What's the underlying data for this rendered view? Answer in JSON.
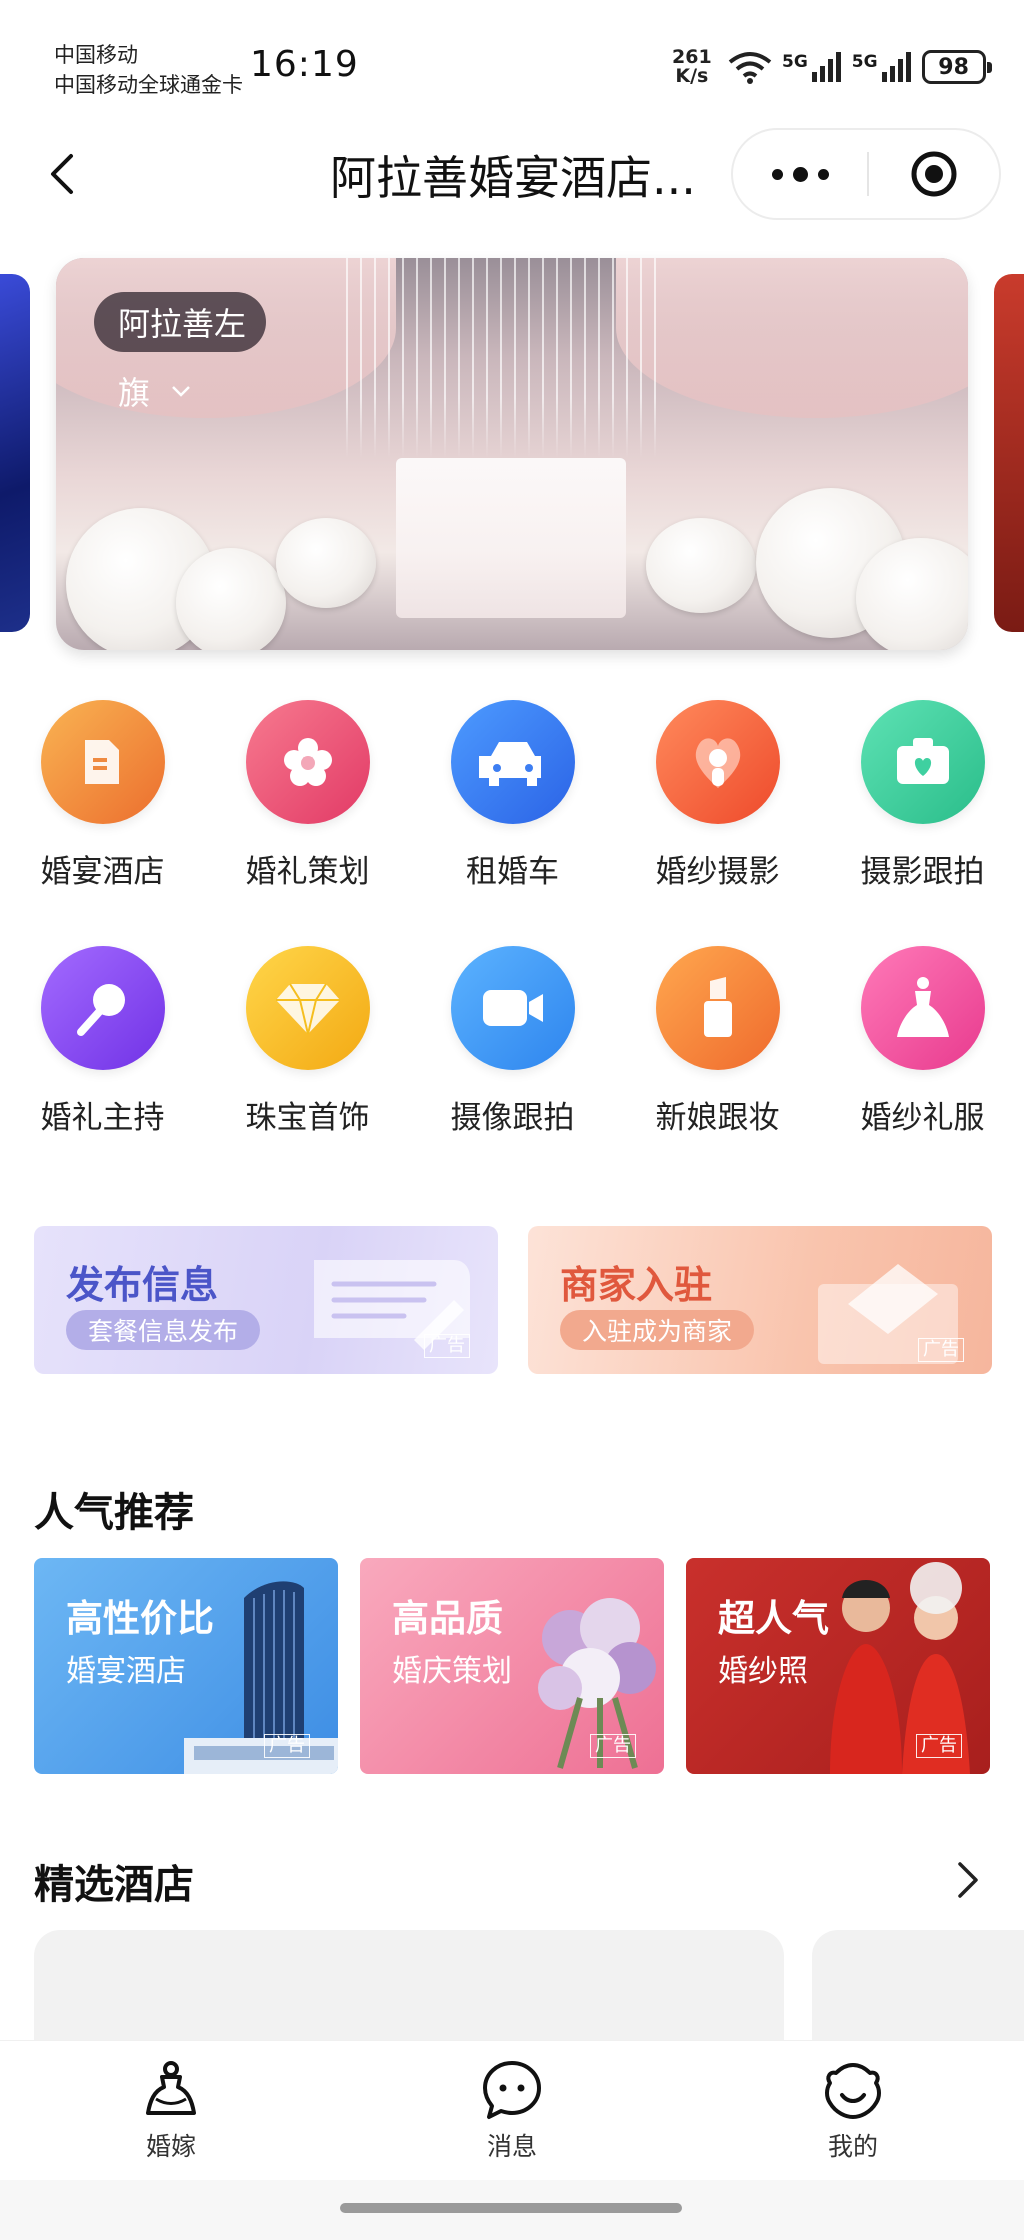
{
  "status_bar": {
    "carrier_line1": "中国移动",
    "carrier_line2": "中国移动全球通金卡",
    "time": "16:19",
    "net_speed_value": "261",
    "net_speed_unit": "K/s",
    "battery": "98",
    "signal_1": "5G",
    "signal_2": "5G"
  },
  "navbar": {
    "title": "阿拉善婚宴酒店...",
    "icons": [
      "back-arrow-icon",
      "more-dots-icon",
      "close-target-icon"
    ]
  },
  "banner": {
    "location_line1": "阿拉善左",
    "location_line2": "旗"
  },
  "categories": [
    {
      "label": "婚宴酒店",
      "icon": "hotel-icon",
      "color": "#f08a3a"
    },
    {
      "label": "婚礼策划",
      "icon": "flower-icon",
      "color": "#ee4f79"
    },
    {
      "label": "租婚车",
      "icon": "car-icon",
      "color": "#2f7ff0"
    },
    {
      "label": "婚纱摄影",
      "icon": "portrait-icon",
      "color": "#f05b3c"
    },
    {
      "label": "摄影跟拍",
      "icon": "camera-icon",
      "color": "#2fcf9a"
    },
    {
      "label": "婚礼主持",
      "icon": "microphone-icon",
      "color": "#8a4bf0"
    },
    {
      "label": "珠宝首饰",
      "icon": "diamond-icon",
      "color": "#f5be1e"
    },
    {
      "label": "摄像跟拍",
      "icon": "video-icon",
      "color": "#3197f0"
    },
    {
      "label": "新娘跟妆",
      "icon": "lipstick-icon",
      "color": "#f07a3d"
    },
    {
      "label": "婚纱礼服",
      "icon": "dress-icon",
      "color": "#f04f9a"
    }
  ],
  "promos": [
    {
      "title": "发布信息",
      "pill": "套餐信息发布",
      "ad": "广告",
      "title_color": "#4b55c8",
      "pill_color": "#b3aee8"
    },
    {
      "title": "商家入驻",
      "pill": "入驻成为商家",
      "ad": "广告",
      "title_color": "#e0583d",
      "pill_color": "#f2a98e"
    }
  ],
  "popular": {
    "title": "人气推荐",
    "cards": [
      {
        "title": "高性价比",
        "subtitle": "婚宴酒店",
        "ad": "广告"
      },
      {
        "title": "高品质",
        "subtitle": "婚庆策划",
        "ad": "广告"
      },
      {
        "title": "超人气",
        "subtitle": "婚纱照",
        "ad": "广告"
      }
    ]
  },
  "selected_hotels": {
    "title": "精选酒店",
    "more_icon": "chevron-right-icon"
  },
  "tabbar": {
    "tabs": [
      {
        "label": "婚嫁",
        "icon": "bride-icon"
      },
      {
        "label": "消息",
        "icon": "message-icon"
      },
      {
        "label": "我的",
        "icon": "profile-icon"
      }
    ]
  }
}
